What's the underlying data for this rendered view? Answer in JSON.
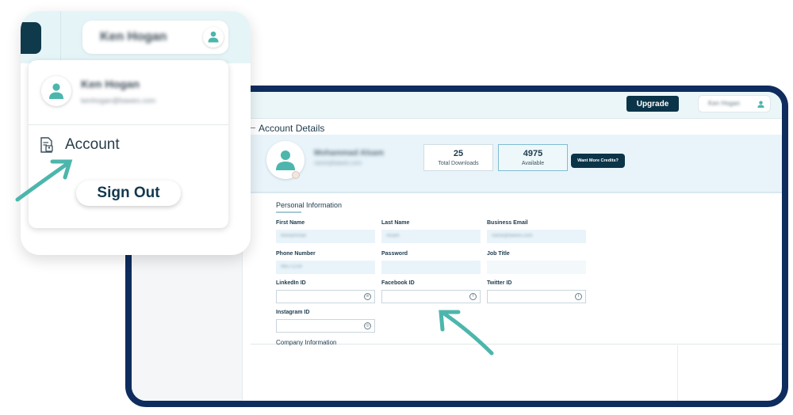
{
  "popup": {
    "user_name": "Ken Hogan",
    "menu": {
      "user_name": "Ken Hogan",
      "user_email": "kenhogan@bawes.com",
      "account_label": "Account",
      "sign_out_label": "Sign Out"
    }
  },
  "app": {
    "upgrade_label": "Upgrade",
    "header_user_name": "Ken Hogan",
    "section_title": "Account Details",
    "profile": {
      "name": "Mohammad Alsam",
      "email": "name@bawes.com"
    },
    "stats": [
      {
        "value": "25",
        "label": "Total Downloads"
      },
      {
        "value": "4975",
        "label": "Available"
      }
    ],
    "credits_button": "Want More Credits?",
    "personal_title": "Personal Information",
    "fields": {
      "first_name": {
        "label": "First Name",
        "value": "Mohammad"
      },
      "last_name": {
        "label": "Last Name",
        "value": "Alsam"
      },
      "business_email": {
        "label": "Business Email",
        "value": "name@bawes.com"
      },
      "phone_number": {
        "label": "Phone Number",
        "value": "96571234"
      },
      "password": {
        "label": "Password",
        "value": ""
      },
      "job_title": {
        "label": "Job Title",
        "value": ""
      },
      "linkedin_id": {
        "label": "LinkedIn ID",
        "value": ""
      },
      "facebook_id": {
        "label": "Facebook ID",
        "value": ""
      },
      "twitter_id": {
        "label": "Twitter ID",
        "value": ""
      },
      "instagram_id": {
        "label": "Instagram ID",
        "value": ""
      }
    },
    "company_title": "Company Information"
  },
  "colors": {
    "brand_dark": "#0b3448",
    "frame_border": "#0f2c5e",
    "accent_teal": "#4db6ac",
    "band_bg": "#e8f4fa"
  },
  "icons": {
    "user": "user-icon",
    "account": "account-document-icon",
    "linkedin": "linkedin-icon",
    "facebook": "facebook-icon",
    "twitter": "twitter-icon",
    "instagram": "instagram-icon",
    "edit": "pencil-icon",
    "arrow": "pointer-arrow-icon"
  }
}
